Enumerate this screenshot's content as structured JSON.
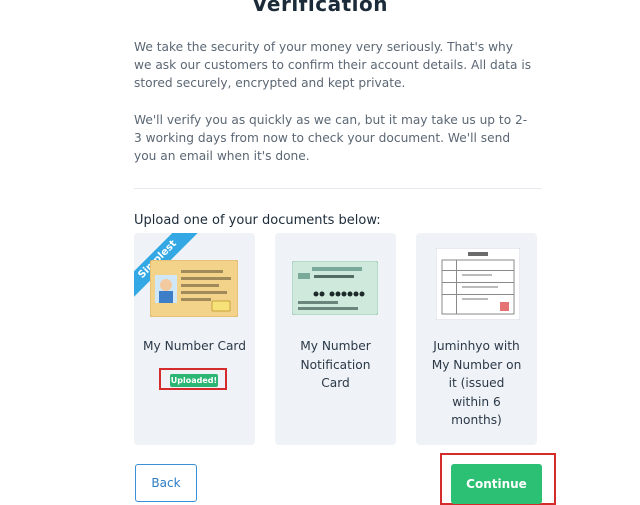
{
  "page": {
    "title": "Verification",
    "intro": "We take the security of your money very seriously. That's why we ask our customers to confirm their account details. All data is stored securely, encrypted and kept private.",
    "timing": "We'll verify you as quickly as we can, but it may take us up to 2-3 working days from now to check your document. We'll send you an email when it's done.",
    "upload_label": "Upload one of your documents below:"
  },
  "documents": [
    {
      "label": "My Number Card",
      "ribbon": "Simplest",
      "status": "Uploaded!",
      "icon": "id-card-icon"
    },
    {
      "label": "My Number Notification Card",
      "icon": "notification-card-icon"
    },
    {
      "label": "Juminhyo with My Number on it (issued within 6 months)",
      "icon": "residence-certificate-icon"
    }
  ],
  "actions": {
    "back": "Back",
    "continue": "Continue"
  },
  "colors": {
    "primary_green": "#2bc073",
    "ribbon_blue": "#34a8e4",
    "highlight_red": "#d42b2b"
  }
}
